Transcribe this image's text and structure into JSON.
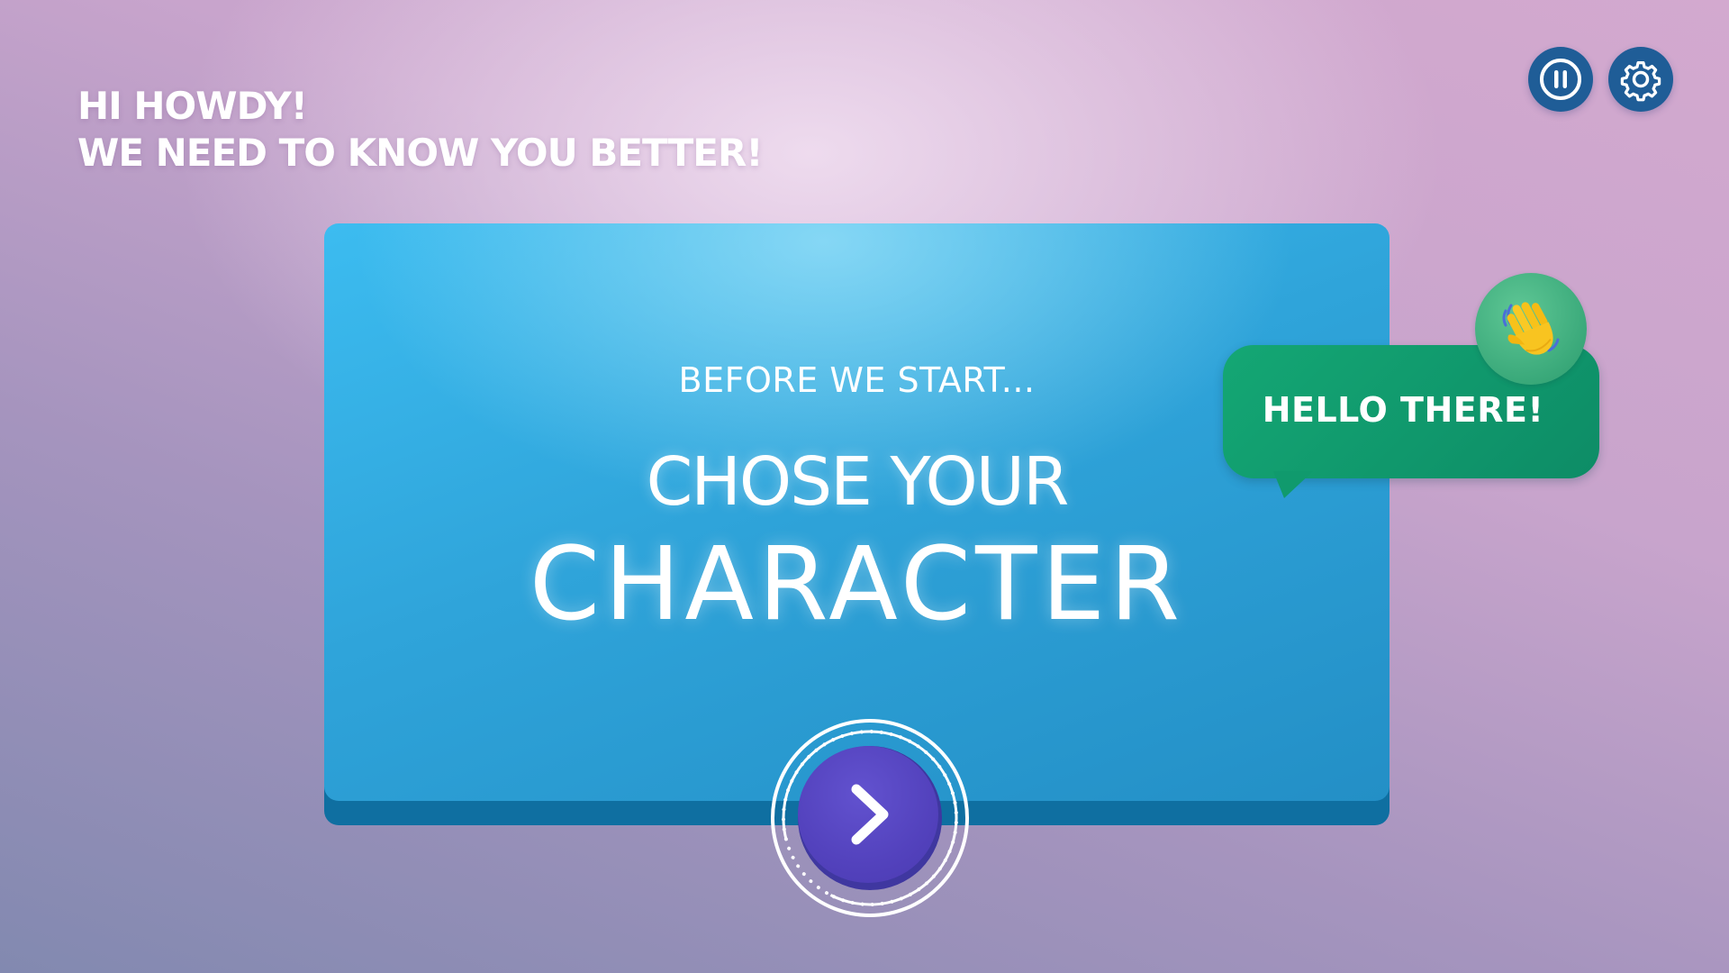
{
  "greeting": {
    "line1": "HI HOWDY!",
    "line2": "WE NEED TO KNOW YOU BETTER!"
  },
  "controls": {
    "pause_icon": "pause-icon",
    "settings_icon": "gear-icon"
  },
  "card": {
    "subtitle": "BEFORE WE START...",
    "title_line1": "CHOSE YOUR",
    "title_line2": "CHARACTER"
  },
  "next_button": {
    "icon": "chevron-right-icon"
  },
  "speech_bubble": {
    "text": "HELLO THERE!",
    "icon": "waving-hand-icon"
  },
  "colors": {
    "background_top": "#d3a9cf",
    "background_bottom": "#8289b0",
    "card_blue": "#2fa4da",
    "control_button": "#1f5d97",
    "next_button": "#5342bd",
    "speech_green": "#14a774",
    "badge_green": "#3aa97a"
  }
}
